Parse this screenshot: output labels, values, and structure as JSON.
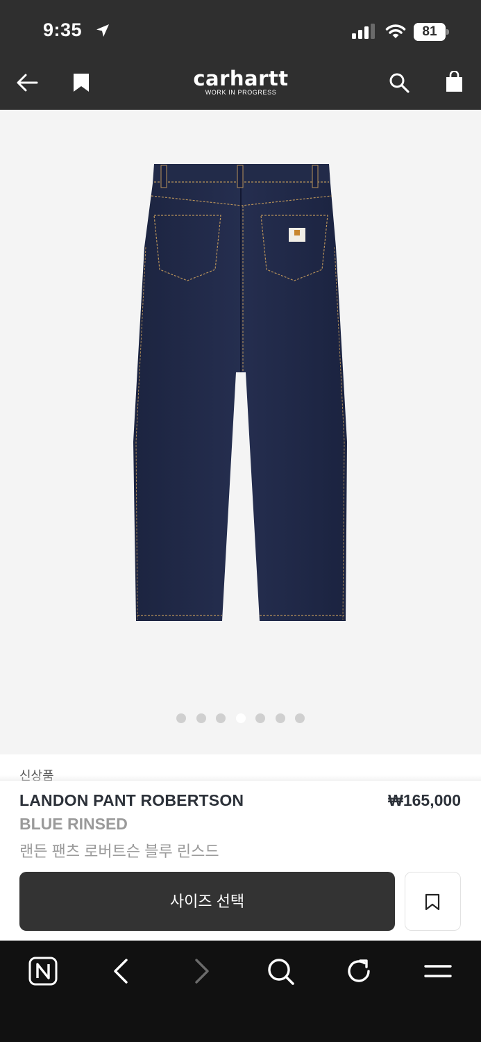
{
  "status_bar": {
    "time": "9:35",
    "battery_percent": "81",
    "battery_level": 0.81,
    "icons": [
      "location-arrow-icon",
      "signal-icon",
      "wifi-icon",
      "battery-icon"
    ]
  },
  "header": {
    "logo_wordmark": "carhartt",
    "logo_tagline": "WORK IN PROGRESS",
    "icons": [
      "back-arrow-icon",
      "bookmark-icon",
      "search-icon",
      "shopping-bag-icon"
    ]
  },
  "gallery": {
    "image_subject": "jeans-back-view",
    "page_count": 7,
    "active_index": 3
  },
  "product": {
    "badge": "신상품",
    "name": "LANDON PANT ROBERTSON",
    "price": "₩165,000",
    "color": "BLUE RINSED",
    "korean_name": "랜든 팬츠 로버트슨 블루 린스드",
    "size_button_label": "사이즈 선택"
  },
  "browser_toolbar": {
    "icons": [
      "naver-n-icon",
      "back-chevron-icon",
      "forward-chevron-icon",
      "search-icon",
      "refresh-icon",
      "menu-icon"
    ]
  },
  "colors": {
    "header_bg": "#2f2f2f",
    "button_bg": "#333333",
    "toolbar_bg": "#111111"
  }
}
